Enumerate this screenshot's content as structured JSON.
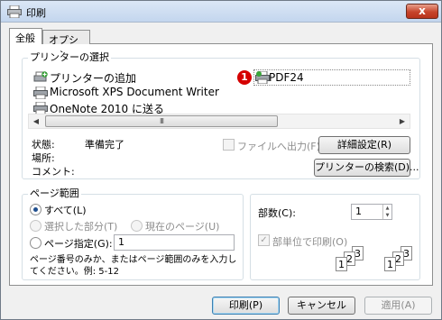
{
  "window": {
    "title": "印刷",
    "close_label": "x"
  },
  "tabs": [
    {
      "label": "全般"
    },
    {
      "label": "オプション"
    }
  ],
  "printer_group": {
    "label": "プリンターの選択",
    "printers": [
      {
        "label": "プリンターの追加",
        "icon": "add-printer-icon"
      },
      {
        "label": "Microsoft XPS Document Writer",
        "icon": "printer-icon"
      },
      {
        "label": "OneNote 2010 に送る",
        "icon": "printer-icon"
      },
      {
        "label": "PDF24",
        "icon": "pdf-printer-icon",
        "selected": true
      }
    ],
    "badge": "1",
    "scroll_thumb_grip": "III"
  },
  "status": {
    "state_label": "状態:",
    "state_value": "準備完了",
    "location_label": "場所:",
    "location_value": "",
    "comment_label": "コメント:",
    "comment_value": ""
  },
  "print_to_file": {
    "label": "ファイルへ出力(F)",
    "checked": false
  },
  "buttons": {
    "preferences": "詳細設定(R)",
    "find_printer": "プリンターの検索(D)...",
    "print": "印刷(P)",
    "cancel": "キャンセル",
    "apply": "適用(A)"
  },
  "page_range": {
    "label": "ページ範囲",
    "all": "すべて(L)",
    "selection": "選択した部分(T)",
    "current_page": "現在のページ(U)",
    "pages": "ページ指定(G):",
    "pages_value": "1",
    "hint": "ページ番号のみか、またはページ範囲のみを入力してください。例: 5-12",
    "selected": "all"
  },
  "copies": {
    "label": "部数(C):",
    "value": "1",
    "collate_label": "部単位で印刷(O)",
    "collate_checked": true
  }
}
